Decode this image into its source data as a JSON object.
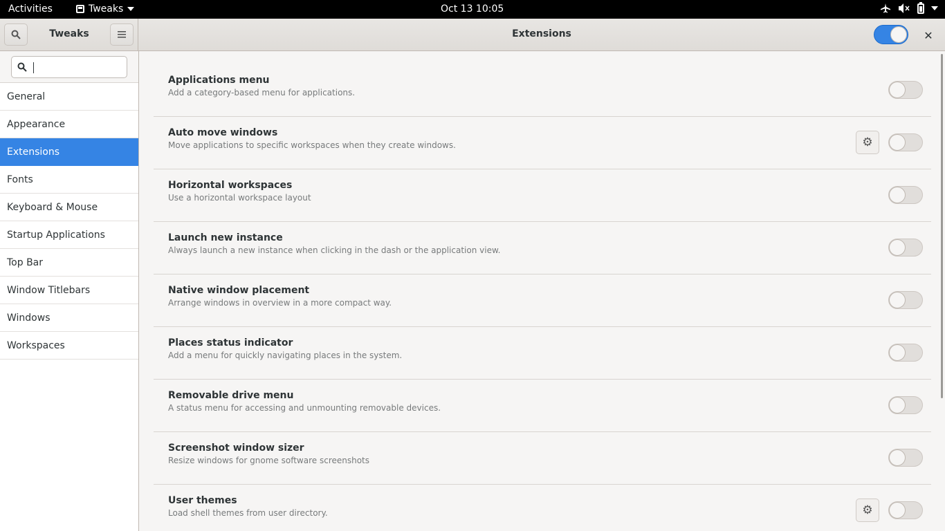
{
  "topbar": {
    "activities": "Activities",
    "app_name": "Tweaks",
    "clock": "Oct 13  10:05",
    "tray_icons": [
      "airplane-icon",
      "volume-muted-icon",
      "battery-icon",
      "system-menu-icon"
    ]
  },
  "headerbar": {
    "left_title": "Tweaks",
    "main_title": "Extensions",
    "master_switch_on": true,
    "accent": "#3584e4"
  },
  "sidebar": {
    "search_placeholder": "",
    "items": [
      {
        "label": "General",
        "active": false
      },
      {
        "label": "Appearance",
        "active": false
      },
      {
        "label": "Extensions",
        "active": true
      },
      {
        "label": "Fonts",
        "active": false
      },
      {
        "label": "Keyboard & Mouse",
        "active": false
      },
      {
        "label": "Startup Applications",
        "active": false
      },
      {
        "label": "Top Bar",
        "active": false
      },
      {
        "label": "Window Titlebars",
        "active": false
      },
      {
        "label": "Windows",
        "active": false
      },
      {
        "label": "Workspaces",
        "active": false
      }
    ]
  },
  "extensions": [
    {
      "name": "Applications menu",
      "desc": "Add a category-based menu for applications.",
      "has_settings": false,
      "enabled": false
    },
    {
      "name": "Auto move windows",
      "desc": "Move applications to specific workspaces when they create windows.",
      "has_settings": true,
      "enabled": false
    },
    {
      "name": "Horizontal workspaces",
      "desc": "Use a horizontal workspace layout",
      "has_settings": false,
      "enabled": false
    },
    {
      "name": "Launch new instance",
      "desc": "Always launch a new instance when clicking in the dash or the application view.",
      "has_settings": false,
      "enabled": false
    },
    {
      "name": "Native window placement",
      "desc": "Arrange windows in overview in a more compact way.",
      "has_settings": false,
      "enabled": false
    },
    {
      "name": "Places status indicator",
      "desc": "Add a menu for quickly navigating places in the system.",
      "has_settings": false,
      "enabled": false
    },
    {
      "name": "Removable drive menu",
      "desc": "A status menu for accessing and unmounting removable devices.",
      "has_settings": false,
      "enabled": false
    },
    {
      "name": "Screenshot window sizer",
      "desc": "Resize windows for gnome software screenshots",
      "has_settings": false,
      "enabled": false
    },
    {
      "name": "User themes",
      "desc": "Load shell themes from user directory.",
      "has_settings": true,
      "enabled": false
    }
  ]
}
